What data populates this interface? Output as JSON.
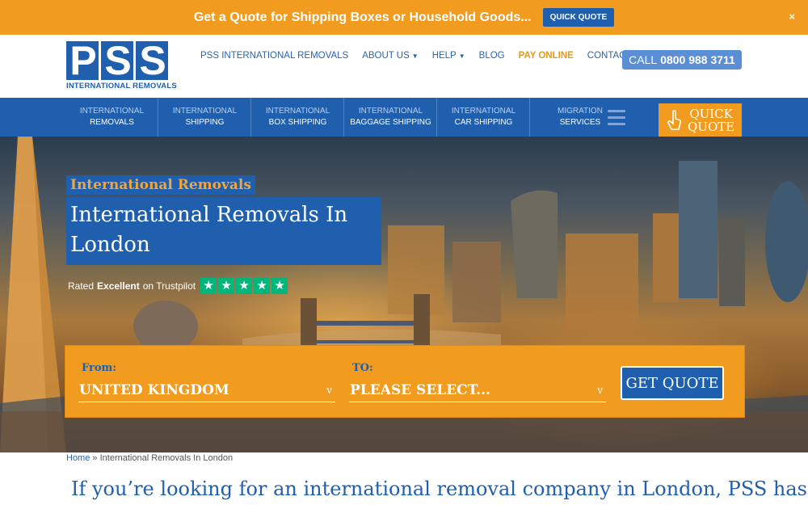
{
  "promo": {
    "text": "Get a Quote for Shipping Boxes or Household Goods...",
    "button": "QUICK QUOTE",
    "close": "×"
  },
  "header": {
    "logo": {
      "letters": [
        "P",
        "S",
        "S"
      ],
      "subtitle": "INTERNATIONAL REMOVALS"
    },
    "nav": [
      {
        "label": "PSS INTERNATIONAL REMOVALS"
      },
      {
        "label": "ABOUT US",
        "dropdown": true
      },
      {
        "label": "HELP",
        "dropdown": true
      },
      {
        "label": "BLOG"
      },
      {
        "label": "PAY ONLINE"
      },
      {
        "label": "CONTACT US"
      }
    ],
    "call": {
      "prefix": "CALL",
      "number": "0800 988 3711"
    }
  },
  "mainnav": {
    "items": [
      {
        "top": "INTERNATIONAL",
        "bottom": "REMOVALS"
      },
      {
        "top": "INTERNATIONAL",
        "bottom": "SHIPPING"
      },
      {
        "top": "INTERNATIONAL",
        "bottom": "BOX SHIPPING"
      },
      {
        "top": "INTERNATIONAL",
        "bottom": "BAGGAGE SHIPPING"
      },
      {
        "top": "INTERNATIONAL",
        "bottom": "CAR SHIPPING"
      }
    ],
    "migration": {
      "top": "MIGRATION",
      "bottom": "SERVICES"
    },
    "quick_quote": {
      "line1": "QUICK",
      "line2": "QUOTE"
    }
  },
  "hero": {
    "subtitle": "International Removals",
    "title": "International Removals In London",
    "trust": {
      "rated": "Rated",
      "excellent": "Excellent",
      "on": "on Trustpilot",
      "stars": 5
    }
  },
  "quote_form": {
    "from_label": "From:",
    "from_value": "UNITED KINGDOM",
    "to_label": "TO:",
    "to_value": "PLEASE SELECT...",
    "submit": "GET QUOTE"
  },
  "breadcrumb": {
    "home": "Home",
    "separator": "»",
    "current": "International Removals In London"
  },
  "intro": "If you’re looking for an international removal company in London, PSS has",
  "colors": {
    "brand_blue": "#1f5fae",
    "accent_orange": "#f29c1f",
    "trustpilot_green": "#00b67a"
  }
}
